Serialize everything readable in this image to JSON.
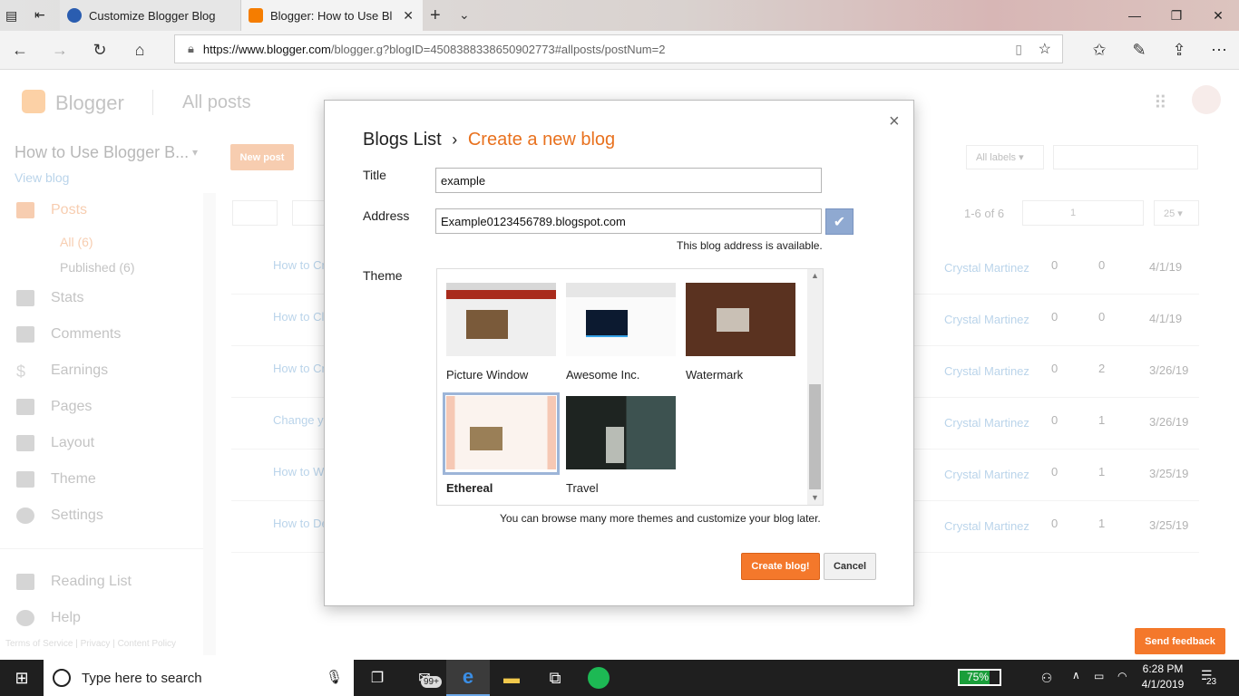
{
  "browser": {
    "tabs": [
      {
        "title": "Customize Blogger Blog"
      },
      {
        "title": "Blogger: How to Use Bl"
      }
    ],
    "url_host": "https://www.blogger.com",
    "url_path": "/blogger.g?blogID=4508388338650902773#allposts/postNum=2"
  },
  "blogger": {
    "logo": "Blogger",
    "section": "All posts",
    "blog_name": "How to Use Blogger B...",
    "view_blog": "View blog",
    "new_post": "New post",
    "all_labels": "All labels",
    "range": "1-6 of 6",
    "page": "1",
    "per_page": "25",
    "nav": {
      "posts": "Posts",
      "all": "All (6)",
      "published": "Published (6)",
      "stats": "Stats",
      "comments": "Comments",
      "earnings": "Earnings",
      "pages": "Pages",
      "layout": "Layout",
      "theme": "Theme",
      "settings": "Settings",
      "reading_list": "Reading List",
      "help": "Help"
    },
    "footer": {
      "terms": "Terms of Service",
      "privacy": "Privacy",
      "content_policy": "Content Policy"
    },
    "posts": [
      {
        "title": "How to Cr",
        "author": "Crystal Martinez",
        "comments": "0",
        "views": "0",
        "date": "4/1/19"
      },
      {
        "title": "How to Cl",
        "author": "Crystal Martinez",
        "comments": "0",
        "views": "0",
        "date": "4/1/19"
      },
      {
        "title": "How to Cr",
        "author": "Crystal Martinez",
        "comments": "0",
        "views": "2",
        "date": "3/26/19"
      },
      {
        "title": "Change y",
        "author": "Crystal Martinez",
        "comments": "0",
        "views": "1",
        "date": "3/26/19"
      },
      {
        "title": "How to W",
        "author": "Crystal Martinez",
        "comments": "0",
        "views": "1",
        "date": "3/25/19"
      },
      {
        "title": "How to De",
        "author": "Crystal Martinez",
        "comments": "0",
        "views": "1",
        "date": "3/25/19"
      }
    ],
    "send_feedback": "Send feedback"
  },
  "dialog": {
    "breadcrumb_root": "Blogs List",
    "breadcrumb_sep": "›",
    "breadcrumb_current": "Create a new blog",
    "title_label": "Title",
    "title_value": "example",
    "address_label": "Address",
    "address_value": "Example0123456789.blogspot.com",
    "address_status": "This blog address is available.",
    "theme_label": "Theme",
    "themes": [
      {
        "name": "Picture Window"
      },
      {
        "name": "Awesome Inc."
      },
      {
        "name": "Watermark"
      },
      {
        "name": "Ethereal",
        "selected": true
      },
      {
        "name": "Travel"
      }
    ],
    "theme_note": "You can browse many more themes and customize your blog later.",
    "create_button": "Create blog!",
    "cancel_button": "Cancel",
    "close": "×"
  },
  "taskbar": {
    "search_placeholder": "Type here to search",
    "mail_badge": "99+",
    "battery": "75%",
    "time": "6:28 PM",
    "date": "4/1/2019",
    "notifications": "23"
  },
  "colors": {
    "accent_orange": "#e8711e",
    "create_button": "#f4782b",
    "check_blue": "#8fa9d1",
    "link_blue": "#3a84c4",
    "taskbar": "#1f1f1f"
  }
}
